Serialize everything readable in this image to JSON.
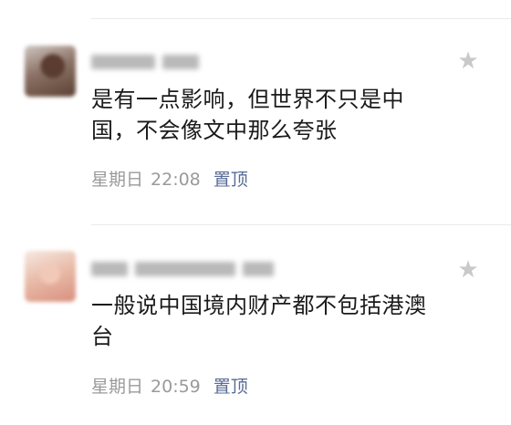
{
  "comments": [
    {
      "content": "是有一点影响，但世界不只是中国，不会像文中那么夸张",
      "day": "星期日",
      "time": "22:08",
      "pin_label": "置顶"
    },
    {
      "content": "一般说中国境内财产都不包括港澳台",
      "day": "星期日",
      "time": "20:59",
      "pin_label": "置顶"
    }
  ],
  "icons": {
    "star": "star-icon"
  },
  "colors": {
    "pin_link": "#576b95",
    "meta_text": "#9a9a9a",
    "star": "#c9c9c9"
  }
}
